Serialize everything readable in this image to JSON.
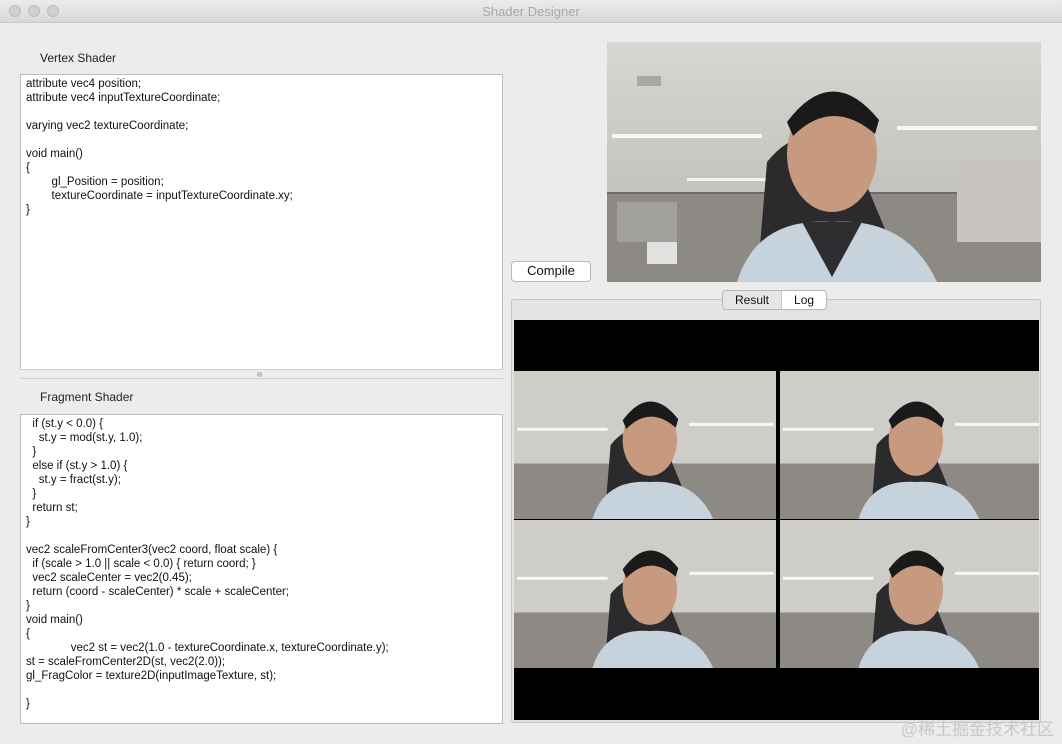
{
  "window": {
    "title": "Shader Designer"
  },
  "vertex": {
    "label": "Vertex Shader",
    "code": "attribute vec4 position;\nattribute vec4 inputTextureCoordinate;\n\nvarying vec2 textureCoordinate;\n\nvoid main()\n{\n        gl_Position = position;\n        textureCoordinate = inputTextureCoordinate.xy;\n}"
  },
  "fragment": {
    "label": "Fragment Shader",
    "code": "  if (st.y < 0.0) {\n    st.y = mod(st.y, 1.0);\n  }\n  else if (st.y > 1.0) {\n    st.y = fract(st.y);\n  }\n  return st;\n}\n\nvec2 scaleFromCenter3(vec2 coord, float scale) {\n  if (scale > 1.0 || scale < 0.0) { return coord; }\n  vec2 scaleCenter = vec2(0.45);\n  return (coord - scaleCenter) * scale + scaleCenter;\n}\nvoid main()\n{\n              vec2 st = vec2(1.0 - textureCoordinate.x, textureCoordinate.y);\nst = scaleFromCenter2D(st, vec2(2.0));\ngl_FragColor = texture2D(inputImageTexture, st);\n\n}"
  },
  "toolbar": {
    "compile_label": "Compile"
  },
  "tabs": {
    "result_label": "Result",
    "log_label": "Log",
    "selected": "Result"
  },
  "watermark": "@稀土掘金技术社区",
  "icons": {
    "close": "traffic-light-close-icon",
    "minimize": "traffic-light-minimize-icon",
    "zoom": "traffic-light-zoom-icon"
  }
}
